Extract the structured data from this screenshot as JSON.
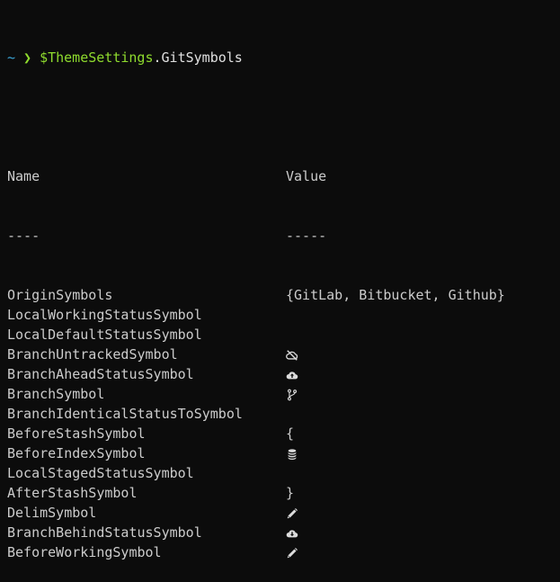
{
  "prompt": {
    "tilde": "~",
    "arrow": "❯",
    "variable": "$ThemeSettings",
    "dot": ".",
    "property": "GitSymbols"
  },
  "table": {
    "headers": {
      "name": "Name",
      "value": "Value"
    },
    "underline": {
      "name": "----",
      "value": "-----"
    },
    "rows": [
      {
        "name": "OriginSymbols",
        "value": "{GitLab, Bitbucket, Github}",
        "icon": ""
      },
      {
        "name": "LocalWorkingStatusSymbol",
        "value": "",
        "icon": ""
      },
      {
        "name": "LocalDefaultStatusSymbol",
        "value": "",
        "icon": ""
      },
      {
        "name": "BranchUntrackedSymbol",
        "value": "",
        "icon": "cloud-off-icon"
      },
      {
        "name": "BranchAheadStatusSymbol",
        "value": "",
        "icon": "cloud-upload-icon"
      },
      {
        "name": "BranchSymbol",
        "value": "",
        "icon": "git-branch-icon"
      },
      {
        "name": "BranchIdenticalStatusToSymbol",
        "value": "",
        "icon": ""
      },
      {
        "name": "BeforeStashSymbol",
        "value": "{",
        "icon": ""
      },
      {
        "name": "BeforeIndexSymbol",
        "value": "",
        "icon": "database-icon"
      },
      {
        "name": "LocalStagedStatusSymbol",
        "value": "",
        "icon": ""
      },
      {
        "name": "AfterStashSymbol",
        "value": "}",
        "icon": ""
      },
      {
        "name": "DelimSymbol",
        "value": "",
        "icon": "pencil-icon"
      },
      {
        "name": "BranchBehindStatusSymbol",
        "value": "",
        "icon": "cloud-download-icon"
      },
      {
        "name": "BeforeWorkingSymbol",
        "value": "",
        "icon": "pencil-icon"
      }
    ]
  },
  "colors": {
    "background": "#0c0c0c",
    "text": "#cccccc",
    "prompt_green": "#8fdb2e",
    "prompt_blue": "#3aa6d8"
  }
}
